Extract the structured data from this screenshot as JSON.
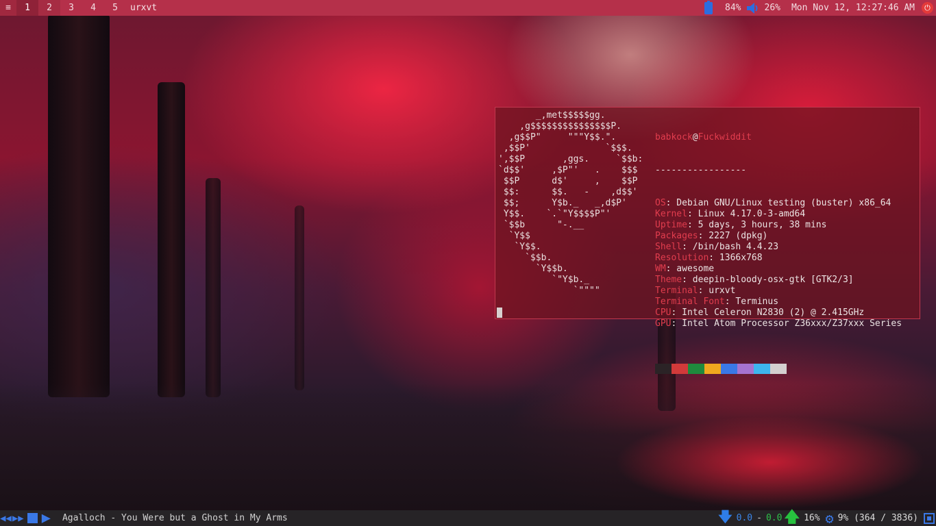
{
  "topbar": {
    "launcher_icon": "awesome-launcher-icon",
    "tags": [
      "1",
      "2",
      "3",
      "4",
      "5"
    ],
    "active_tag": "1",
    "window_title": "urxvt",
    "battery_icon": "battery-icon",
    "battery": "84%",
    "volume_icon": "speaker-icon",
    "volume": "26%",
    "clock": "Mon Nov 12, 12:27:46 AM",
    "power_icon": "power-icon"
  },
  "terminal": {
    "logo_lines": [
      "       _,met$$$$$gg.",
      "    ,g$$$$$$$$$$$$$$$P.",
      "  ,g$$P\"     \"\"\"Y$$.\".",
      " ,$$P'              `$$$.",
      "',$$P       ,ggs.     `$$b:",
      "`d$$'     ,$P\"'   .    $$$",
      " $$P      d$'     ,    $$P",
      " $$:      $$.   -    ,d$$'",
      " $$;      Y$b._   _,d$P'",
      " Y$$.    `.`\"Y$$$$P\"'",
      " `$$b      \"-.__",
      "  `Y$$",
      "   `Y$$.",
      "     `$$b.",
      "       `Y$$b.",
      "          `\"Y$b._",
      "              `\"\"\"\""
    ],
    "user": "babkock",
    "at": "@",
    "host": "Fuckwiddit",
    "separator": "-----------------",
    "info": [
      {
        "key": "OS",
        "value": ": Debian GNU/Linux testing (buster) x86_64"
      },
      {
        "key": "Kernel",
        "value": ": Linux 4.17.0-3-amd64"
      },
      {
        "key": "Uptime",
        "value": ": 5 days, 3 hours, 38 mins"
      },
      {
        "key": "Packages",
        "value": ": 2227 (dpkg)"
      },
      {
        "key": "Shell",
        "value": ": /bin/bash 4.4.23"
      },
      {
        "key": "Resolution",
        "value": ": 1366x768"
      },
      {
        "key": "WM",
        "value": ": awesome"
      },
      {
        "key": "Theme",
        "value": ": deepin-bloody-osx-gtk [GTK2/3]"
      },
      {
        "key": "Terminal",
        "value": ": urxvt"
      },
      {
        "key": "Terminal Font",
        "value": ": Terminus"
      },
      {
        "key": "CPU",
        "value": ": Intel Celeron N2830 (2) @ 2.415GHz"
      },
      {
        "key": "GPU",
        "value": ": Intel Atom Processor Z36xxx/Z37xxx Series"
      }
    ],
    "palette": [
      "#2b2326",
      "#d23a3a",
      "#1f8a3d",
      "#f0a81f",
      "#3a78e6",
      "#a573cf",
      "#3db6ee",
      "#d4d0d0"
    ]
  },
  "bottombar": {
    "prev_icon": "rewind-icon",
    "next_icon": "fast-forward-icon",
    "stop_icon": "stop-icon",
    "play_icon": "play-icon",
    "song": "Agalloch - You Were but a Ghost in My Arms",
    "download_icon": "download-arrow-icon",
    "net_down": "0.0",
    "net_sep": "-",
    "net_up": "0.0",
    "upload_icon": "upload-arrow-icon",
    "cpu": "16%",
    "gear_icon": "gear-icon",
    "mem": "9% (364 / 3836)",
    "chip_icon": "chip-icon"
  }
}
